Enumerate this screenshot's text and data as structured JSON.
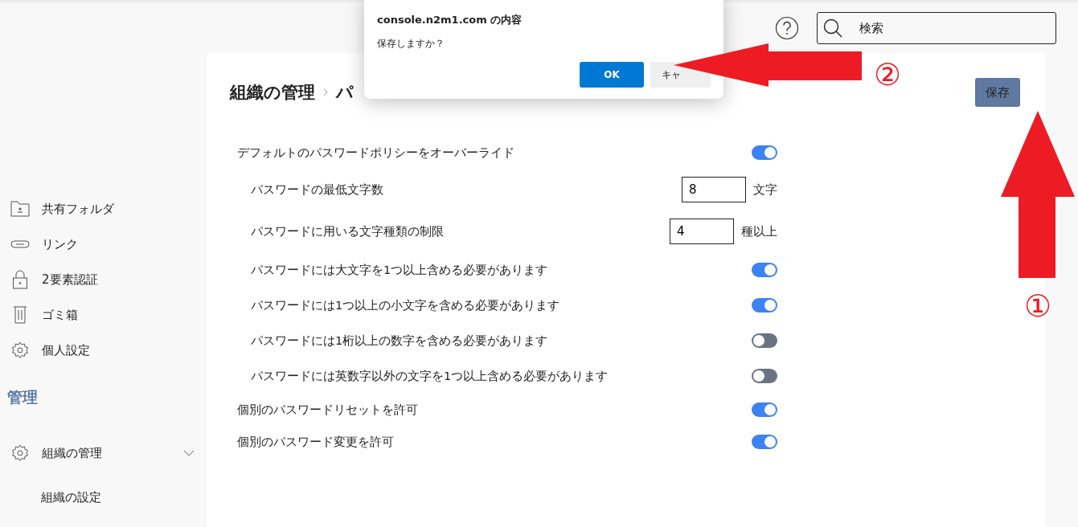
{
  "header": {
    "search": {
      "placeholder": "検索"
    }
  },
  "sidebar": {
    "items": [
      {
        "label": "共有フォルダ"
      },
      {
        "label": "リンク"
      },
      {
        "label": "2要素認証"
      },
      {
        "label": "ゴミ箱"
      },
      {
        "label": "個人設定"
      }
    ],
    "section": {
      "title": "管理",
      "items": [
        {
          "label": "組織の管理",
          "expanded": true,
          "children": [
            {
              "label": "組織の設定"
            }
          ]
        }
      ]
    }
  },
  "breadcrumb": [
    "組織の管理",
    "パ"
  ],
  "save_button": "保存",
  "settings": [
    {
      "kind": "toggle",
      "label": "デフォルトのパスワードポリシーをオーバーライド",
      "on": true,
      "children": [
        {
          "kind": "number",
          "label": "パスワードの最低文字数",
          "value": "8",
          "unit": "文字"
        },
        {
          "kind": "number",
          "label": "パスワードに用いる文字種類の制限",
          "value": "4",
          "unit": "種以上"
        },
        {
          "kind": "toggle",
          "label": "パスワードには大文字を1つ以上含める必要があります",
          "on": true
        },
        {
          "kind": "toggle",
          "label": "パスワードには1つ以上の小文字を含める必要があります",
          "on": true
        },
        {
          "kind": "toggle",
          "label": "パスワードには1桁以上の数字を含める必要があります",
          "on": false
        },
        {
          "kind": "toggle",
          "label": "パスワードには英数字以外の文字を1つ以上含める必要があります",
          "on": false
        }
      ]
    },
    {
      "kind": "toggle",
      "label": "個別のパスワードリセットを許可",
      "on": true
    },
    {
      "kind": "toggle",
      "label": "個別のパスワード変更を許可",
      "on": true
    }
  ],
  "dialog": {
    "title": "console.n2m1.com の内容",
    "message": "保存しますか？",
    "buttons": [
      "OK",
      "キャ"
    ]
  },
  "annotations": [
    {
      "number": "①"
    },
    {
      "number": "②"
    }
  ]
}
